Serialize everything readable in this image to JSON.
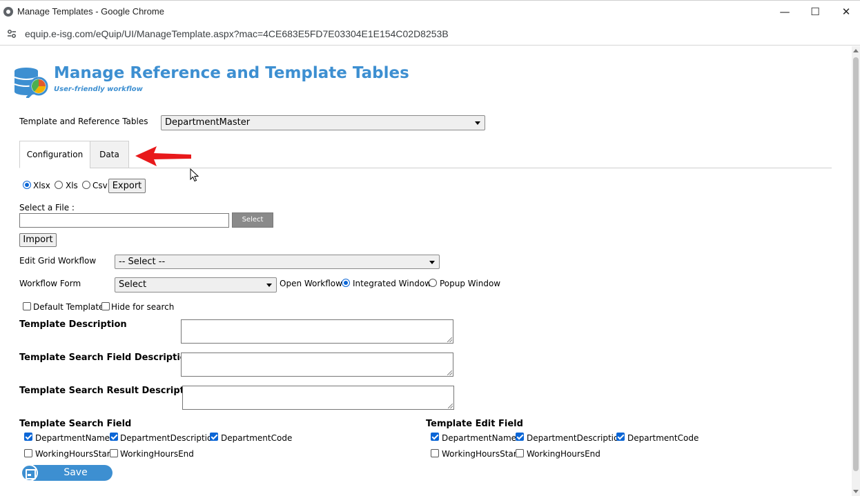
{
  "window": {
    "title": "Manage Templates - Google Chrome",
    "minimize_glyph": "—",
    "maximize_glyph": "☐",
    "close_glyph": "✕"
  },
  "address_bar": {
    "url": "equip.e-isg.com/eQuip/UI/ManageTemplate.aspx?mac=4CE683E5FD7E03304E1E154C02D8253B"
  },
  "header": {
    "title": "Manage Reference and Template Tables",
    "subtitle": "User-friendly workflow"
  },
  "template_selector": {
    "label": "Template and Reference Tables",
    "value": "DepartmentMaster"
  },
  "tabs": [
    {
      "label": "Configuration",
      "active": true
    },
    {
      "label": "Data",
      "active": false
    }
  ],
  "export": {
    "formats": [
      {
        "label": "Xlsx",
        "checked": true
      },
      {
        "label": "Xls",
        "checked": false
      },
      {
        "label": "Csv",
        "checked": false
      }
    ],
    "button_label": "Export"
  },
  "file_select": {
    "label": "Select a File :",
    "value": "",
    "select_label": "Select",
    "import_label": "Import"
  },
  "edit_grid_workflow": {
    "label": "Edit Grid Workflow",
    "value": "-- Select --"
  },
  "workflow_form": {
    "label": "Workflow Form",
    "value": "Select",
    "open_label": "Open Workflow",
    "options": [
      {
        "label": "Integrated Window",
        "checked": true
      },
      {
        "label": "Popup Window",
        "checked": false
      }
    ]
  },
  "flags": [
    {
      "label": "Default Template",
      "checked": false
    },
    {
      "label": "Hide for search",
      "checked": false
    }
  ],
  "descriptions": [
    {
      "label": "Template Description",
      "value": ""
    },
    {
      "label": "Template Search Field Description",
      "value": ""
    },
    {
      "label": "Template Search Result Description",
      "value": ""
    }
  ],
  "search_fields": {
    "title": "Template Search Field",
    "fields": [
      {
        "label": "DepartmentName",
        "checked": true
      },
      {
        "label": "DepartmentDescription",
        "checked": true
      },
      {
        "label": "DepartmentCode",
        "checked": true
      },
      {
        "label": "WorkingHoursStart",
        "checked": false
      },
      {
        "label": "WorkingHoursEnd",
        "checked": false
      }
    ]
  },
  "edit_fields": {
    "title": "Template Edit Field",
    "fields": [
      {
        "label": "DepartmentName",
        "checked": true
      },
      {
        "label": "DepartmentDescription",
        "checked": true
      },
      {
        "label": "DepartmentCode",
        "checked": true
      },
      {
        "label": "WorkingHoursStart",
        "checked": false
      },
      {
        "label": "WorkingHoursEnd",
        "checked": false
      }
    ]
  },
  "save": {
    "label": "Save"
  },
  "colors": {
    "brand": "#3d8fd1",
    "accent": "#0b66d6",
    "annotation_arrow": "#e8191b"
  },
  "icons": [
    "chrome-icon",
    "site-settings-icon",
    "database-logo-icon",
    "save-disk-icon",
    "red-arrow-annotation",
    "mouse-cursor-icon"
  ]
}
